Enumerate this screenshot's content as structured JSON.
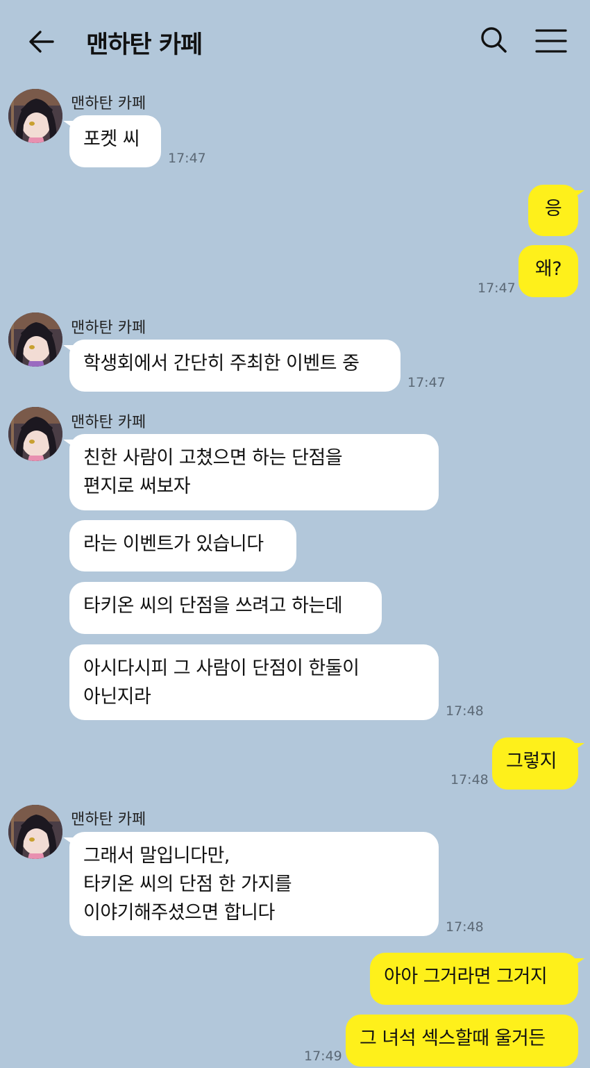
{
  "header": {
    "title": "맨하탄 카페",
    "icons": {
      "back": "back-arrow-icon",
      "search": "search-icon",
      "menu": "hamburger-menu-icon"
    }
  },
  "colors": {
    "background": "#b2c7da",
    "incoming_bubble": "#ffffff",
    "outgoing_bubble": "#fef01b",
    "time_text": "#5b6875"
  },
  "messages": [
    {
      "sender": "맨하탄 카페",
      "time": "17:47",
      "bubbles": [
        "포켓 씨"
      ]
    },
    {
      "sender": "me",
      "time": "17:47",
      "bubbles": [
        "응",
        "왜?"
      ]
    },
    {
      "sender": "맨하탄 카페",
      "time": "17:47",
      "bubbles": [
        "학생회에서 간단히 주최한 이벤트 중"
      ]
    },
    {
      "sender": "맨하탄 카페",
      "time": "17:48",
      "bubbles": [
        "친한 사람이 고쳤으면 하는 단점을\n편지로 써보자",
        "라는 이벤트가 있습니다",
        "타키온 씨의 단점을 쓰려고 하는데",
        "아시다시피 그 사람이 단점이 한둘이\n아닌지라"
      ]
    },
    {
      "sender": "me",
      "time": "17:48",
      "bubbles": [
        "그렇지"
      ]
    },
    {
      "sender": "맨하탄 카페",
      "time": "17:48",
      "bubbles": [
        "그래서 말입니다만,\n타키온 씨의 단점 한 가지를\n이야기해주셨으면 합니다"
      ]
    },
    {
      "sender": "me",
      "time": "17:49",
      "bubbles": [
        "아아 그거라면 그거지",
        "그 녀석 섹스할때 울거든"
      ]
    }
  ]
}
